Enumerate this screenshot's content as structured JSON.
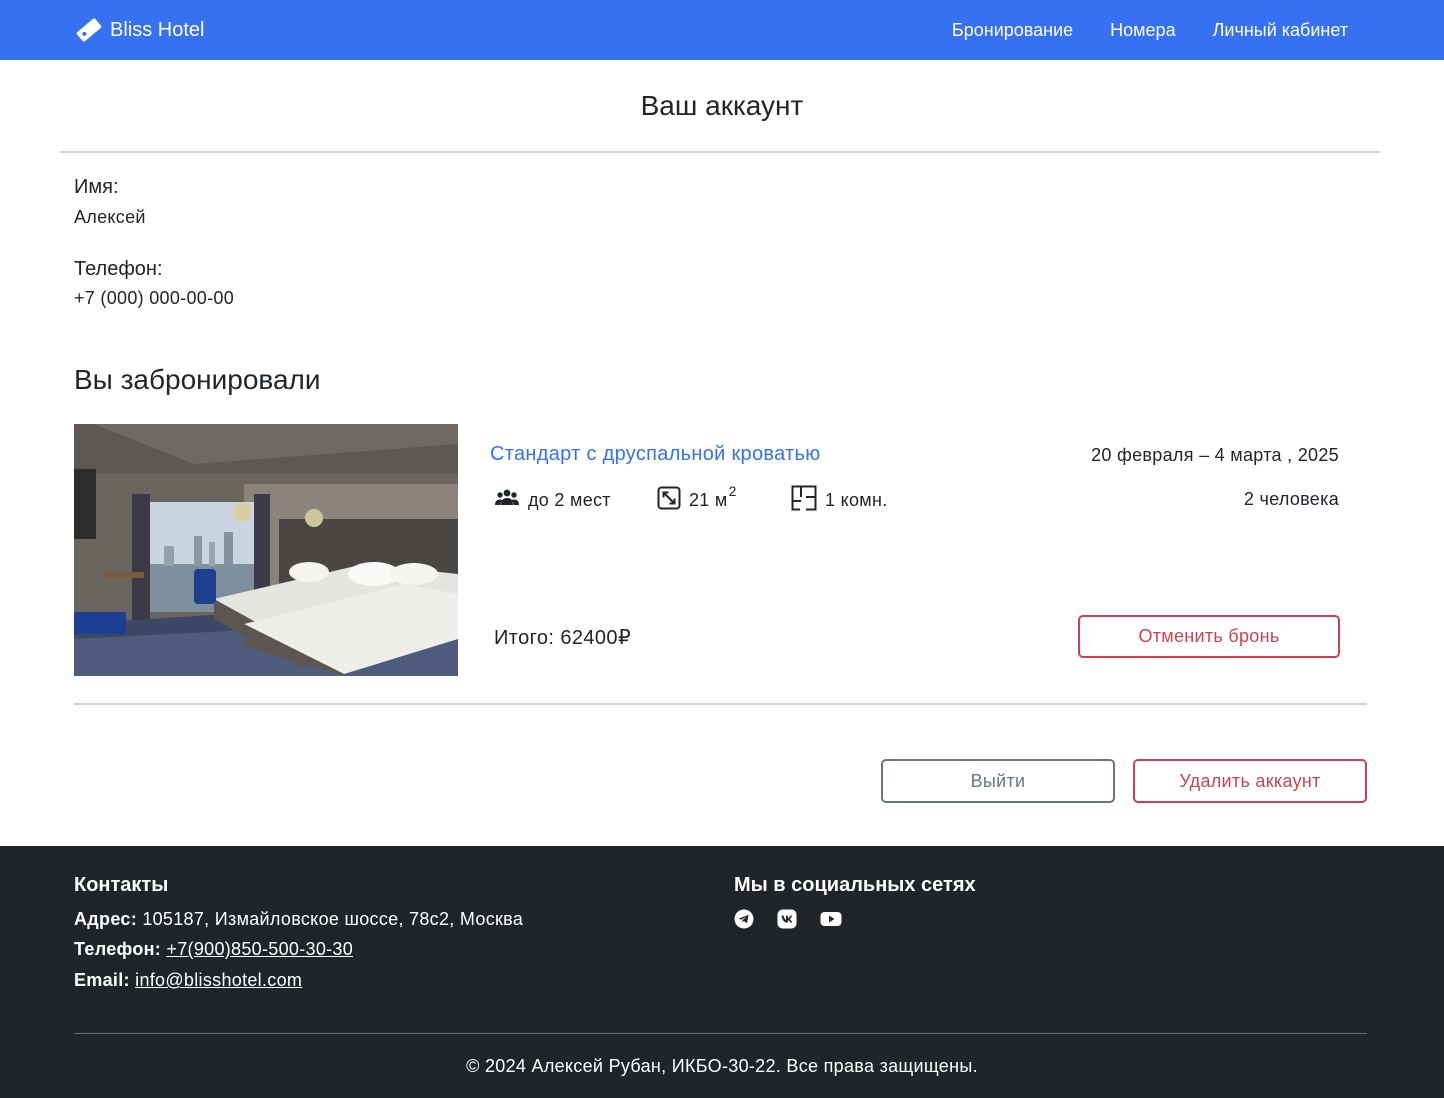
{
  "brand": {
    "name": "Bliss Hotel",
    "icon": "ticket-icon"
  },
  "nav": {
    "items": [
      {
        "label": "Бронирование"
      },
      {
        "label": "Номера"
      },
      {
        "label": "Личный кабинет"
      }
    ]
  },
  "account": {
    "title": "Ваш аккаунт",
    "name_label": "Имя:",
    "name_value": "Алексей",
    "phone_label": "Телефон:",
    "phone_value": "+7 (000) 000-00-00"
  },
  "bookings": {
    "section_title": "Вы забронировали",
    "items": [
      {
        "room_name": "Стандарт с друспальной кроватью",
        "dates": "20 февраля – 4 марта , 2025",
        "guests": "2 человека",
        "capacity": "до 2 мест",
        "area": "21 м",
        "area_unit_sup": "2",
        "rooms": "1 комн.",
        "total": "Итого: 62400₽",
        "cancel_label": "Отменить бронь"
      }
    ]
  },
  "actions": {
    "logout_label": "Выйти",
    "delete_label": "Удалить аккаунт"
  },
  "footer": {
    "contacts_heading": "Контакты",
    "address_label": "Адрес:",
    "address_value": "105187, Измайловское шоссе, 78с2, Москва",
    "phone_label": "Телефон:",
    "phone_value": "+7(900)850-500-30-30",
    "email_label": "Email:",
    "email_value": "info@blisshotel.com",
    "social_heading": "Мы в социальных сетях",
    "social_icons": [
      "telegram-icon",
      "vk-icon",
      "youtube-icon"
    ],
    "copyright": "© 2024 Алексей Рубан, ИКБО-30-22. Все права защищены."
  },
  "colors": {
    "primary": "#3571f0",
    "danger": "#c9434f",
    "secondary": "#6c757d",
    "footer_bg": "#212529"
  }
}
